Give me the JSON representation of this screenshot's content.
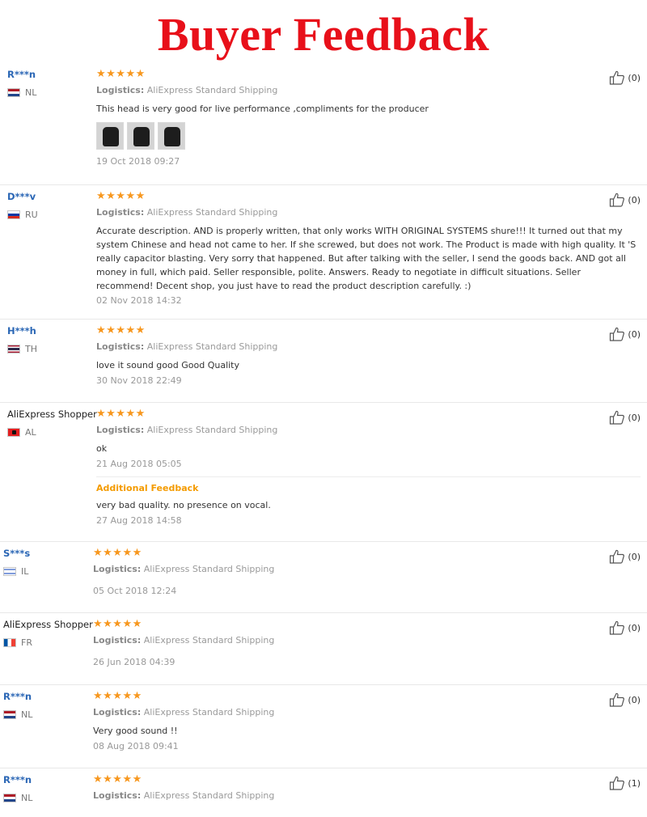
{
  "page_title": "Buyer Feedback",
  "logistics_label": "Logistics:",
  "icons": {
    "rating": "star-icon",
    "like": "thumbs-up-icon"
  },
  "colors": {
    "title": "#e8101a",
    "stars": "#f7971e",
    "username": "#2a66b5",
    "additional": "#f49b00"
  },
  "reviews": [
    {
      "user": "R***n",
      "country": "NL",
      "stars": "★★★★★",
      "logistics": "AliExpress Standard Shipping",
      "text": "This head is very good for live performance ,compliments for the producer",
      "photos": 3,
      "date": "19 Oct 2018 09:27",
      "likes": "(0)"
    },
    {
      "user": "D***v",
      "country": "RU",
      "stars": "★★★★★",
      "logistics": "AliExpress Standard Shipping",
      "text": "Accurate description. AND is properly written, that only works WITH ORIGINAL SYSTEMS shure!!! It turned out that my system Chinese and head not came to her. If she screwed, but does not work. The Product is made with high quality. It 'S really capacitor blasting. Very sorry that happened. But after talking with the seller, I send the goods back. AND got all money in full, which paid. Seller responsible, polite. Answers. Ready to negotiate in difficult situations. Seller recommend! Decent shop, you just have to read the product description carefully. :)",
      "date": "02 Nov 2018 14:32",
      "likes": "(0)"
    },
    {
      "user": "H***h",
      "country": "TH",
      "stars": "★★★★★",
      "logistics": "AliExpress Standard Shipping",
      "text": "love it sound good Good Quality",
      "date": "30 Nov 2018 22:49",
      "likes": "(0)"
    },
    {
      "user": "AliExpress Shopper",
      "country": "AL",
      "stars": "★★★★★",
      "logistics": "AliExpress Standard Shipping",
      "text": "ok",
      "date": "21 Aug 2018 05:05",
      "likes": "(0)",
      "additional_title": "Additional Feedback",
      "additional_text": "very bad quality. no presence on vocal.",
      "additional_date": "27 Aug 2018 14:58"
    },
    {
      "user": "S***s",
      "country": "IL",
      "stars": "★★★★★",
      "logistics": "AliExpress Standard Shipping",
      "date": "05 Oct 2018 12:24",
      "likes": "(0)"
    },
    {
      "user": "AliExpress Shopper",
      "country": "FR",
      "stars": "★★★★★",
      "logistics": "AliExpress Standard Shipping",
      "date": "26 Jun 2018 04:39",
      "likes": "(0)"
    },
    {
      "user": "R***n",
      "country": "NL",
      "stars": "★★★★★",
      "logistics": "AliExpress Standard Shipping",
      "text": "Very good sound !!",
      "date": "08 Aug 2018 09:41",
      "likes": "(0)"
    },
    {
      "user": "R***n",
      "country": "NL",
      "stars": "★★★★★",
      "logistics": "AliExpress Standard Shipping",
      "likes": "(1)"
    }
  ]
}
